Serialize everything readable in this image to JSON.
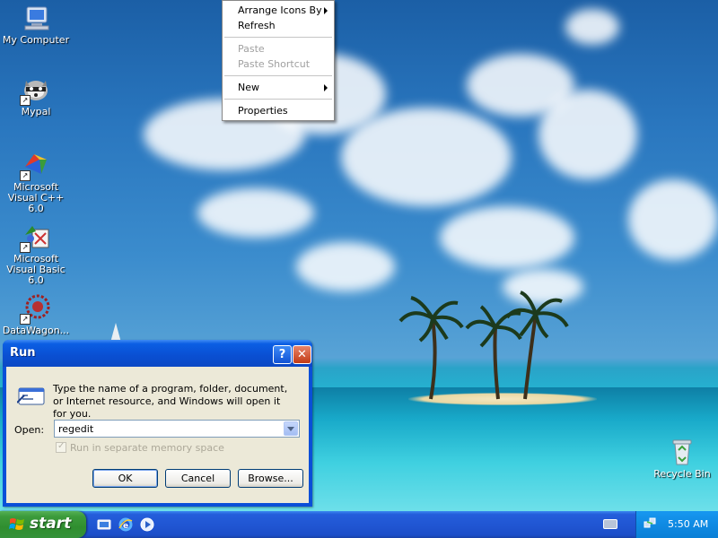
{
  "desktop": {
    "icons": [
      {
        "label": "My Computer",
        "icon": "my-computer-icon"
      },
      {
        "label": "Mypal",
        "icon": "mypal-icon"
      },
      {
        "label": "Microsoft Visual C++ 6.0",
        "icon": "visual-cpp-icon"
      },
      {
        "label": "Microsoft Visual Basic 6.0",
        "icon": "visual-basic-icon"
      },
      {
        "label": "DataWagon...",
        "icon": "datawagon-icon"
      },
      {
        "label": "Recycle Bin",
        "icon": "recycle-bin-icon"
      }
    ]
  },
  "context_menu": {
    "items": [
      {
        "label": "Arrange Icons By",
        "submenu": true,
        "enabled": true
      },
      {
        "label": "Refresh",
        "submenu": false,
        "enabled": true
      },
      {
        "label": "Paste",
        "submenu": false,
        "enabled": false
      },
      {
        "label": "Paste Shortcut",
        "submenu": false,
        "enabled": false
      },
      {
        "label": "New",
        "submenu": true,
        "enabled": true
      },
      {
        "label": "Properties",
        "submenu": false,
        "enabled": true
      }
    ]
  },
  "run_dialog": {
    "title": "Run",
    "description": "Type the name of a program, folder, document, or Internet resource, and Windows will open it for you.",
    "open_label": "Open:",
    "open_value": "regedit",
    "checkbox_label": "Run in separate memory space",
    "checkbox_checked": true,
    "checkbox_enabled": false,
    "ok_label": "OK",
    "cancel_label": "Cancel",
    "browse_label": "Browse...",
    "help_label": "?",
    "close_label": "✕"
  },
  "taskbar": {
    "start_label": "start",
    "quick_launch": [
      "show-desktop-icon",
      "internet-explorer-icon",
      "media-player-icon"
    ],
    "clock": "5:50 AM"
  },
  "colors": {
    "taskbar_blue": "#245edb",
    "start_green": "#3c9b3c",
    "title_blue": "#0a4fd2",
    "dialog_face": "#ece9d8"
  }
}
